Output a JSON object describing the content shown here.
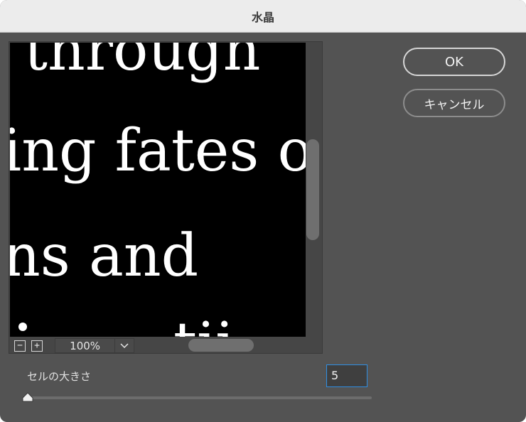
{
  "window": {
    "title": "水晶"
  },
  "preview": {
    "text_lines": [
      "through",
      "ing fates o",
      "ns and",
      "tii"
    ],
    "zoom": {
      "value": "100%"
    },
    "zoom_out_symbol": "−",
    "zoom_in_symbol": "+",
    "dropdown_symbol": "⌄"
  },
  "buttons": {
    "ok": "OK",
    "cancel": "キャンセル"
  },
  "cell_size": {
    "label": "セルの大きさ",
    "value": "5",
    "min": 3,
    "max": 300
  },
  "colors": {
    "dialog_bg": "#535353",
    "titlebar_bg": "#ececec",
    "focus": "#2f8fe3"
  }
}
